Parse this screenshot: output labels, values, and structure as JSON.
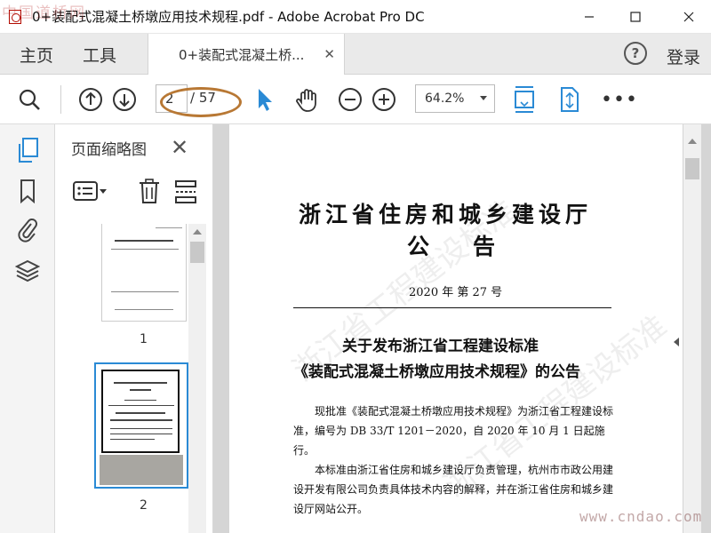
{
  "window": {
    "title": "0+装配式混凝土桥墩应用技术规程.pdf - Adobe Acrobat Pro DC",
    "watermark_top": "中国道桥网"
  },
  "tabs": {
    "home": "主页",
    "tools": "工具",
    "document_tab": "0+装配式混凝土桥..."
  },
  "header": {
    "login": "登录",
    "help_symbol": "?"
  },
  "toolbar": {
    "page_current": "2",
    "page_total": "/ 57",
    "zoom": "64.2%",
    "more": "•••"
  },
  "sidebar": {
    "panel_title": "页面缩略图"
  },
  "thumbnails": [
    {
      "label": "1"
    },
    {
      "label": "2"
    }
  ],
  "document": {
    "department": "浙江省住房和城乡建设厅",
    "notice_chars": [
      "公",
      "告"
    ],
    "doc_number": "2020 年 第 27 号",
    "title_line1": "关于发布浙江省工程建设标准",
    "title_line2": "《装配式混凝土桥墩应用技术规程》的公告",
    "paragraph1": "现批准《装配式混凝土桥墩应用技术规程》为浙江省工程建设标准，编号为 DB 33/T 1201－2020，自 2020 年 10 月 1 日起施行。",
    "paragraph2": "本标准由浙江省住房和城乡建设厅负责管理，杭州市市政公用建设开发有限公司负责具体技术内容的解释，并在浙江省住房和城乡建设厅网站公开。"
  },
  "watermark_bottom": "www.cndao.com",
  "colors": {
    "accent": "#2a8ad5",
    "oval": "#b87834",
    "panel_bg": "#f4f4f4",
    "doc_bg": "#d5d5d5"
  },
  "icons": {
    "search": "search-icon",
    "prev_page": "arrow-up-circle-icon",
    "next_page": "arrow-down-circle-icon",
    "select": "cursor-icon",
    "hand": "hand-icon",
    "zoom_out": "zoom-out-icon",
    "zoom_in": "zoom-in-icon",
    "fit_page": "fit-page-icon",
    "rotate": "rotate-view-icon",
    "thumbnails": "pages-icon",
    "bookmarks": "bookmark-icon",
    "attachments": "paperclip-icon",
    "layers": "layers-icon"
  }
}
